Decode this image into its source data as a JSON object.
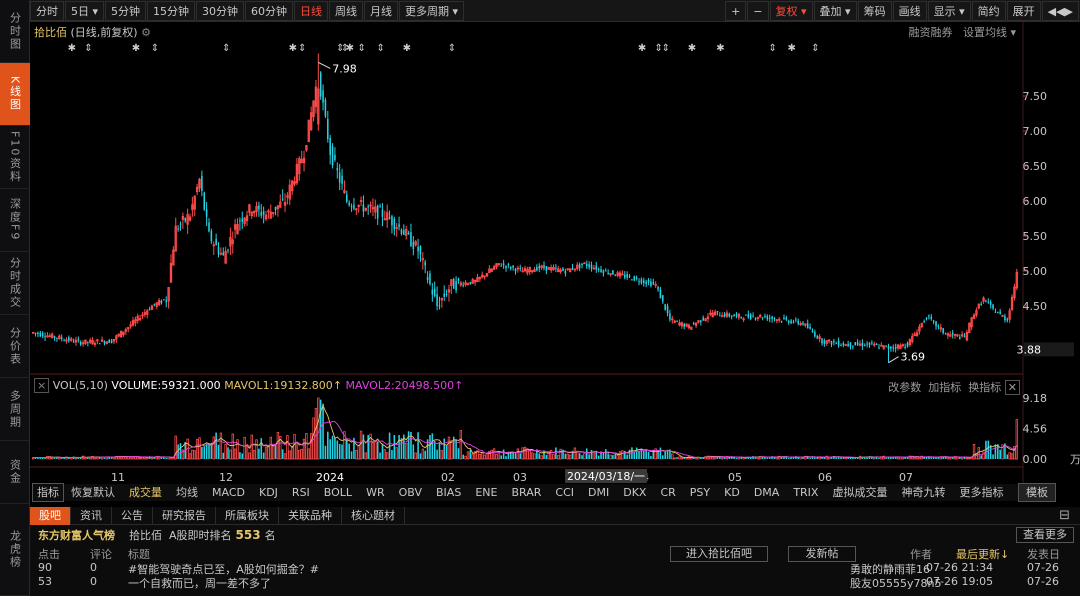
{
  "sidebar": {
    "items": [
      "分时图",
      "K线图",
      "F10资料",
      "深度F9",
      "分时成交",
      "分价表",
      "多周期",
      "资金",
      "龙虎榜"
    ],
    "active": 1
  },
  "toolbar": {
    "left": [
      "分时",
      "5日 ▾",
      "5分钟",
      "15分钟",
      "30分钟",
      "60分钟",
      "日线",
      "周线",
      "月线",
      "更多周期 ▾"
    ],
    "active_index": 6,
    "right": [
      "+",
      "−",
      "复权 ▾",
      "叠加 ▾",
      "筹码",
      "画线",
      "显示 ▾",
      "简约",
      "展开"
    ],
    "nav": "◀◀▶"
  },
  "chart": {
    "stock_name": "拾比佰",
    "mode": "(日线,前复权)",
    "right_links": [
      "融资融券",
      "设置均线 ▾"
    ],
    "high_label": "7.98",
    "low_label": "3.69",
    "last_price": "3.88",
    "price_ticks": [
      "7.50",
      "7.00",
      "6.50",
      "6.00",
      "5.50",
      "5.00",
      "4.50"
    ],
    "crosshair_date": "2024/03/18/一",
    "date_ticks": [
      "11",
      "12",
      "2024",
      "02",
      "03",
      "04",
      "05",
      "06",
      "07"
    ]
  },
  "volume": {
    "label": "VOL(5,10)",
    "volume": "VOLUME:59321.000",
    "mavol1": "MAVOL1:19132.800",
    "mavol2": "MAVOL2:20498.500",
    "right_links": [
      "改参数",
      "加指标",
      "换指标"
    ],
    "ticks": [
      "9.18",
      "4.56",
      "0.00"
    ],
    "unit": "万"
  },
  "indicators": {
    "items": [
      "指标",
      "恢复默认",
      "成交量",
      "均线",
      "MACD",
      "KDJ",
      "RSI",
      "BOLL",
      "WR",
      "OBV",
      "BIAS",
      "ENE",
      "BRAR",
      "CCI",
      "DMI",
      "DKX",
      "CR",
      "PSY",
      "KD",
      "DMA",
      "TRIX",
      "虚拟成交量",
      "神奇九转",
      "更多指标"
    ],
    "active_index": 2,
    "template": "模板"
  },
  "bottom": {
    "tabs": [
      "股吧",
      "资讯",
      "公告",
      "研究报告",
      "所属板块",
      "关联品种",
      "核心题材"
    ],
    "active_tab": 0,
    "logo": "东方财富人气榜",
    "stock": "拾比佰",
    "rank_label": "A股即时排名",
    "rank": "553",
    "rank_unit": "名",
    "more": "查看更多",
    "enter_btn": "进入拾比佰吧",
    "post_btn": "发新帖",
    "columns": [
      "点击",
      "评论",
      "标题",
      "作者",
      "最后更新↓",
      "发表日"
    ],
    "rows": [
      {
        "clicks": "90",
        "comments": "0",
        "title": "#智能驾驶奇点已至，A股如何掘金？#",
        "author": "勇敢的静雨菲16",
        "updated": "07-26 21:34",
        "posted": "07-26"
      },
      {
        "clicks": "53",
        "comments": "0",
        "title": "一个自救而已，周一差不多了",
        "author": "股友05555y78n5",
        "updated": "07-26 19:05",
        "posted": "07-26"
      }
    ]
  },
  "colors": {
    "up": "#ff4b4b",
    "down": "#22d3e6",
    "accent": "#e0531a",
    "gold": "#e6c66a",
    "magenta": "#e040e0"
  }
}
